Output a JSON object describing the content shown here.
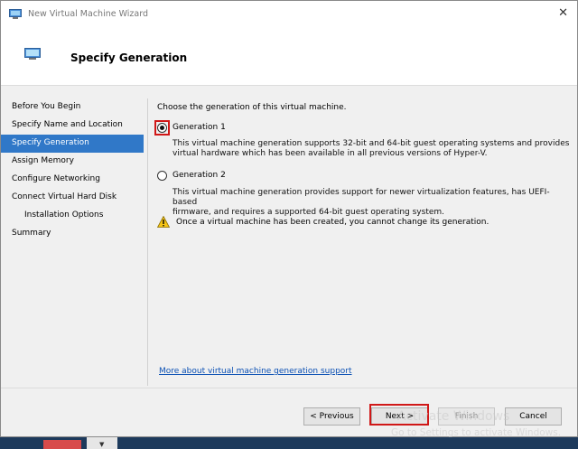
{
  "window": {
    "title": "New Virtual Machine Wizard",
    "close_glyph": "✕"
  },
  "header": {
    "title": "Specify Generation"
  },
  "nav": {
    "items": [
      {
        "label": "Before You Begin"
      },
      {
        "label": "Specify Name and Location"
      },
      {
        "label": "Specify Generation"
      },
      {
        "label": "Assign Memory"
      },
      {
        "label": "Configure Networking"
      },
      {
        "label": "Connect Virtual Hard Disk"
      },
      {
        "label": "Installation Options"
      },
      {
        "label": "Summary"
      }
    ],
    "active_index": 2
  },
  "content": {
    "intro": "Choose the generation of this virtual machine.",
    "options": [
      {
        "label": "Generation 1",
        "selected": true,
        "description_line1": "This virtual machine generation supports 32-bit and 64-bit guest operating systems and provides",
        "description_line2": "virtual hardware which has been available in all previous versions of Hyper-V."
      },
      {
        "label": "Generation 2",
        "selected": false,
        "description_line1": "This virtual machine generation provides support for newer virtualization features, has UEFI-based",
        "description_line2": "firmware, and requires a supported 64-bit guest operating system."
      }
    ],
    "warning": "Once a virtual machine has been created, you cannot change its generation.",
    "more_link": "More about virtual machine generation support"
  },
  "buttons": {
    "previous": "< Previous",
    "next": "Next >",
    "finish": "Finish",
    "cancel": "Cancel"
  },
  "watermark": {
    "line1": "Activate Windows",
    "line2": "Go to Settings to activate Windows."
  },
  "colors": {
    "accent": "#3078c8",
    "highlight": "#d01818",
    "link": "#0b50b4"
  },
  "icons": {
    "app": "vm-monitor-icon",
    "warning": "warning-triangle-icon",
    "close": "close-icon"
  }
}
